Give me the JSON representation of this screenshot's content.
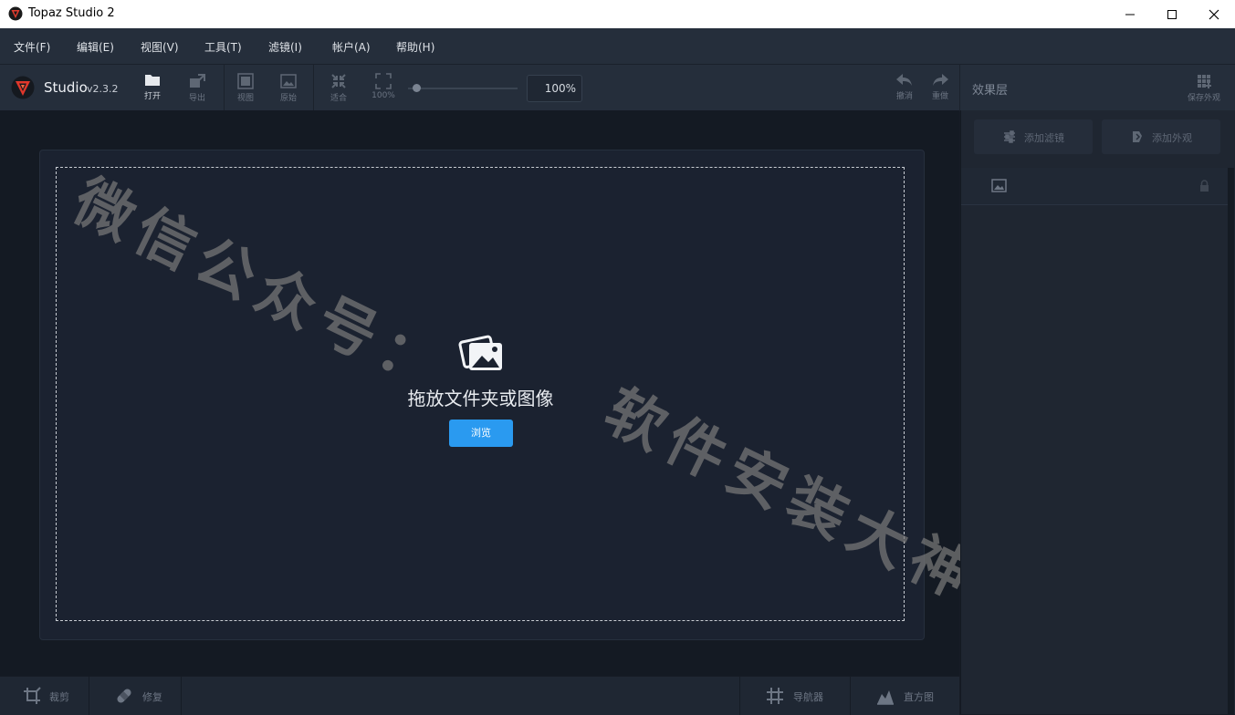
{
  "window": {
    "title": "Topaz Studio 2"
  },
  "menu": [
    {
      "label": "文件(F)"
    },
    {
      "label": "编辑(E)"
    },
    {
      "label": "视图(V)"
    },
    {
      "label": "工具(T)"
    },
    {
      "label": "滤镜(I)"
    },
    {
      "label": "帐户(A)"
    },
    {
      "label": "帮助(H)"
    }
  ],
  "toolbar": {
    "studio_name": "Studio",
    "version": "v2.3.2",
    "open": "打开",
    "export": "导出",
    "view": "视图",
    "original": "原始",
    "fit": "适合",
    "zoom100": "100%",
    "zoom_value": "100%",
    "undo": "撤消",
    "redo": "重做"
  },
  "right_panel": {
    "title": "效果层",
    "save_look": "保存外观",
    "add_filter": "添加滤镜",
    "add_look": "添加外观"
  },
  "canvas": {
    "drop_text": "拖放文件夹或图像",
    "browse": "浏览"
  },
  "bottom": {
    "crop": "裁剪",
    "repair": "修复",
    "navigator": "导航器",
    "histogram": "直方图"
  },
  "watermark": {
    "line1": "微信公众号：",
    "line2": "软件安装大神"
  },
  "colors": {
    "accent": "#2a9af0",
    "bg": "#171c26",
    "panel": "#252e3b"
  }
}
